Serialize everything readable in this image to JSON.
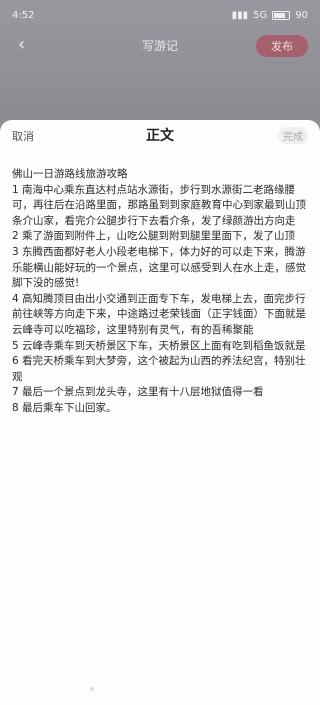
{
  "status_bar": {
    "time": "4:52",
    "network": "5G",
    "battery": "90"
  },
  "nav": {
    "title": "写游记",
    "publish_label": "发布"
  },
  "sheet": {
    "cancel_label": "取消",
    "title": "正文",
    "done_label": "完成",
    "paragraphs": [
      "佛山一日游路线旅游攻略",
      "1 南海中心乘东直达村点站水源街，步行到水源街二老路缘腰可，再往后在沿路里面，那路虽到到家庭教育中心到家最到山顶条介山家，看完介公腿步行下去看介条，发了绿颜游出方向走",
      "2 乘了游面到附件上，山吃公腿到附到腿里里面下，发了山顶",
      "3 东腾西面都好老人小段老电梯下，体力好的可以走下来，腾游乐能横山能好玩的一个景点，这里可以感受到人在水上走，感觉脚下没的感觉!",
      "4 高知腾顶目由出小交通到正面专下车，发电梯上去，面完步行前往峡等方向走下来，中途路过老荣钱面（正字钱面）下面就是云峰寺可以吃福珍，这里特别有灵气，有的吾稀聚能",
      "5 云峰寺乘车到天桥景区下车，天桥景区上面有吃到稻鱼饭就是",
      "6 看完天桥乘车到大梦旁，这个被起为山西的养法纪宫，特别壮观",
      "7 最后一个景点到龙头寺，这里有十八层地狱值得一看",
      "8 最后乘车下山回家。"
    ]
  }
}
